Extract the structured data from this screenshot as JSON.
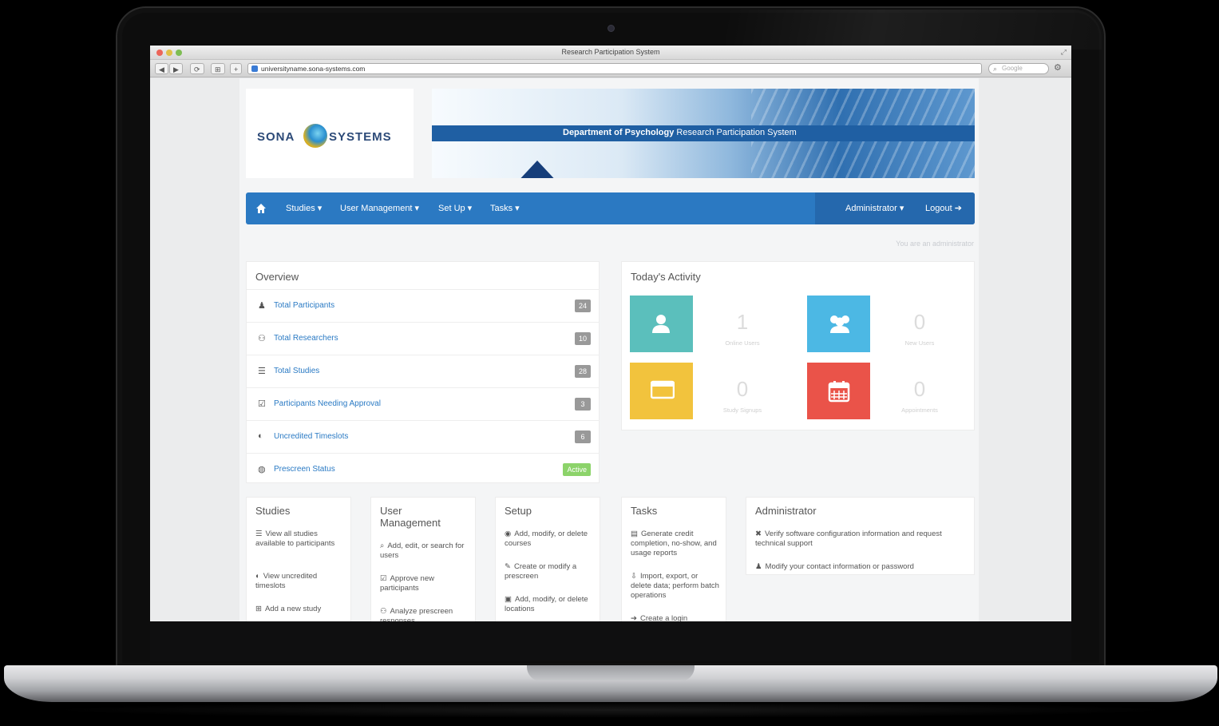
{
  "browser": {
    "window_title": "Research Participation System",
    "url": "universityname.sona-systems.com",
    "search_placeholder": "Google",
    "nav_buttons": [
      "◀",
      "▶",
      "⟳",
      "⊞",
      "+"
    ]
  },
  "logo": {
    "left": "SONA",
    "right": "SYSTEMS"
  },
  "banner": {
    "title_bold": "Department of Psychology",
    "title_rest": "Research Participation System"
  },
  "navbar": {
    "items": [
      "Studies ▾",
      "User Management ▾",
      "Set Up ▾",
      "Tasks ▾"
    ],
    "right_items": [
      "Administrator ▾",
      "Logout ➔"
    ]
  },
  "admin_sub": "You are an administrator",
  "overview": {
    "title": "Overview",
    "rows": [
      {
        "icon": "user-icon",
        "glyph": "♟",
        "label": "Total Participants",
        "badge": "24",
        "badge_color": "#999999"
      },
      {
        "icon": "group-icon",
        "glyph": "⚇",
        "label": "Total Researchers",
        "badge": "10",
        "badge_color": "#999999"
      },
      {
        "icon": "list-icon",
        "glyph": "☰",
        "label": "Total Studies",
        "badge": "28",
        "badge_color": "#999999"
      },
      {
        "icon": "check-icon",
        "glyph": "☑",
        "label": "Participants Needing Approval",
        "badge": "3",
        "badge_color": "#999999"
      },
      {
        "icon": "clock-icon",
        "glyph": "◐",
        "label": "Uncredited Timeslots",
        "badge": "6",
        "badge_color": "#999999"
      },
      {
        "icon": "globe-icon",
        "glyph": "◍",
        "label": "Prescreen Status",
        "badge": "Active",
        "badge_color": "#8cd36a"
      }
    ]
  },
  "activity": {
    "title": "Today's Activity",
    "tiles": [
      {
        "icon": "user-icon",
        "color": "#5bbfbc",
        "value": "1",
        "label": "Online Users"
      },
      {
        "icon": "group-icon",
        "color": "#4cb8e4",
        "value": "0",
        "label": "New Users"
      },
      {
        "icon": "calendar-icon",
        "color": "#f2c33d",
        "value": "0",
        "label": "Study Signups"
      },
      {
        "icon": "calendar-grid-icon",
        "color": "#ea5349",
        "value": "0",
        "label": "Appointments"
      }
    ]
  },
  "sections": {
    "studies": {
      "title": "Studies",
      "items": [
        "View all studies available to participants",
        "View uncredited timeslots",
        "Add a new study"
      ]
    },
    "user_management": {
      "title": "User Management",
      "items": [
        "Add, edit, or search for users",
        "Approve new participants",
        "Analyze prescreen responses"
      ]
    },
    "setup": {
      "title": "Setup",
      "items": [
        "Add, modify, or delete courses",
        "Create or modify a prescreen",
        "Add, modify, or delete locations"
      ]
    },
    "tasks": {
      "title": "Tasks",
      "items": [
        "Generate credit completion, no-show, and usage reports",
        "Import, export, or delete data; perform batch operations",
        "Create a login"
      ]
    },
    "administrator": {
      "title": "Administrator",
      "items": [
        "Verify software configuration information and request technical support",
        "Modify your contact information or password"
      ]
    }
  },
  "colors": {
    "nav": "#2b79c2",
    "link": "#2a7ac4",
    "accent_green": "#8cd36a"
  }
}
